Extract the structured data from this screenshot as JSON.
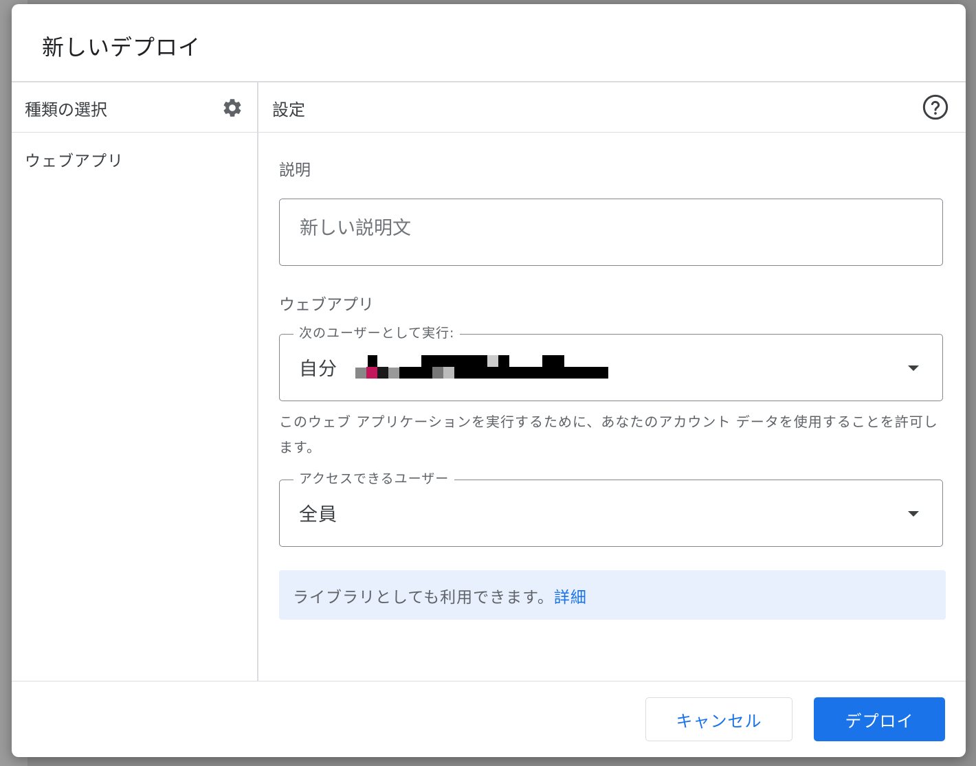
{
  "dialog": {
    "title": "新しいデプロイ"
  },
  "sidebar": {
    "header": "種類の選択",
    "settings_icon": "gear-icon",
    "items": [
      {
        "label": "ウェブアプリ"
      }
    ]
  },
  "main": {
    "header": "設定",
    "help_icon": "help-circle-icon",
    "description": {
      "label": "説明",
      "placeholder": "新しい説明文",
      "value": ""
    },
    "webapp": {
      "section_label": "ウェブアプリ",
      "execute_as": {
        "label": "次のユーザーとして実行:",
        "value": "自分"
      },
      "hint": "このウェブ アプリケーションを実行するために、あなたのアカウント データを使用することを許可します。",
      "access": {
        "label": "アクセスできるユーザー",
        "value": "全員"
      }
    },
    "info": {
      "text": "ライブラリとしても利用できます。",
      "link": "詳細",
      "background": "#e8f0fe",
      "link_color": "#1a73e8"
    }
  },
  "footer": {
    "cancel_label": "キャンセル",
    "deploy_label": "デプロイ",
    "primary_color": "#1a73e8"
  }
}
